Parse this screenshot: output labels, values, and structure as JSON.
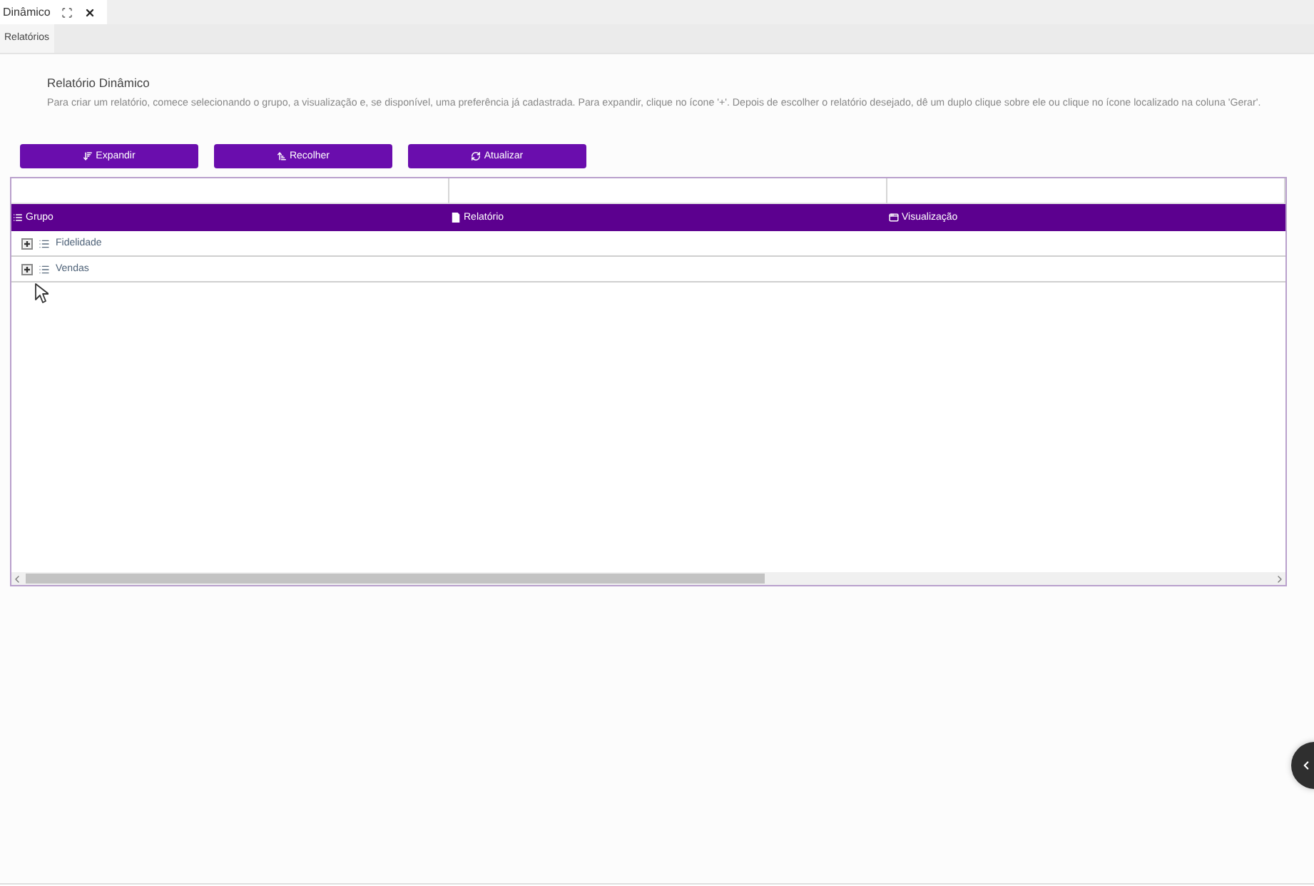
{
  "window_tabs": [
    {
      "label": "Dinâmico",
      "selected": true
    }
  ],
  "sub_tabs": [
    {
      "label": "Relatórios",
      "selected": true
    }
  ],
  "report": {
    "title": "Relatório Dinâmico",
    "description": "Para criar um relatório, comece selecionando o grupo, a visualização e, se disponível, uma preferência já cadastrada. Para expandir, clique no ícone '+'. Depois de escolher o relatório desejado, dê um duplo clique sobre ele ou clique no ícone localizado na coluna 'Gerar'."
  },
  "buttons": [
    {
      "kind": "expand",
      "label": "Expandir"
    },
    {
      "kind": "collapse",
      "label": "Recolher"
    },
    {
      "kind": "refresh",
      "label": "Atualizar"
    }
  ],
  "table": {
    "columns": [
      {
        "kind": "list",
        "label": "Grupo"
      },
      {
        "kind": "document",
        "label": "Relatório"
      },
      {
        "kind": "window",
        "label": "Visualização"
      }
    ],
    "rows": [
      {
        "label": "Fidelidade",
        "expanded": false
      },
      {
        "label": "Vendas",
        "expanded": false
      }
    ]
  }
}
